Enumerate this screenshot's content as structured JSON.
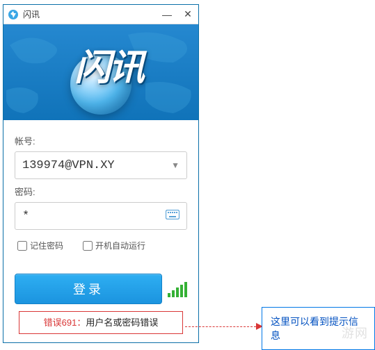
{
  "window": {
    "title": "闪讯",
    "logo_text": "闪讯"
  },
  "form": {
    "account_label": "帐号:",
    "account_value": "139974@VPN.XY",
    "password_label": "密码:",
    "password_value": "*",
    "remember_label": "记住密码",
    "autorun_label": "开机自动运行",
    "login_label": "登录"
  },
  "error": {
    "code_text": "错误691：",
    "message": "用户名或密码错误"
  },
  "annotation": {
    "callout_text": "这里可以看到提示信息"
  },
  "watermark": "游网",
  "signal": {
    "bars": 5
  }
}
